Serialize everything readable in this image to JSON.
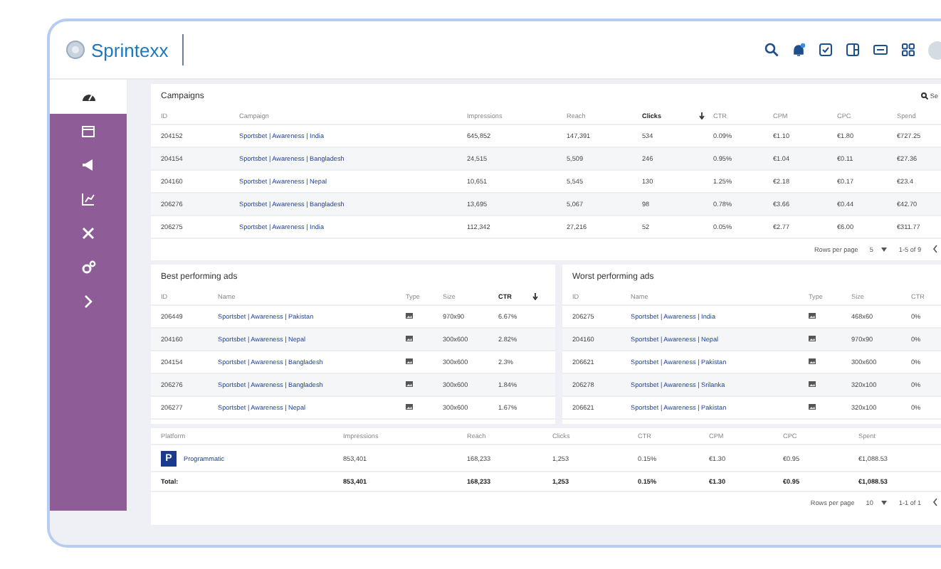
{
  "header": {
    "brand": "Sprintexx"
  },
  "sidebar": {
    "items": [
      {
        "selected": true
      },
      {
        "selected": false
      },
      {
        "selected": false
      },
      {
        "selected": false
      },
      {
        "selected": false
      },
      {
        "selected": false
      },
      {
        "selected": false
      }
    ]
  },
  "campaigns": {
    "title": "Campaigns",
    "search": "Se",
    "columns": [
      {
        "label": "ID",
        "kind": "text",
        "sorted": false
      },
      {
        "label": "Campaign",
        "kind": "link",
        "sorted": false
      },
      {
        "label": "Impressions",
        "kind": "text",
        "sorted": false
      },
      {
        "label": "Reach",
        "kind": "text",
        "sorted": false
      },
      {
        "label": "Clicks",
        "kind": "text",
        "sorted": true
      },
      {
        "label": "CTR",
        "kind": "text",
        "sorted": false
      },
      {
        "label": "CPM",
        "kind": "text",
        "sorted": false
      },
      {
        "label": "CPC",
        "kind": "text",
        "sorted": false
      },
      {
        "label": "Spend",
        "kind": "text",
        "sorted": false
      }
    ],
    "rows": [
      [
        "204152",
        "Sportsbet | Awareness | India",
        "645,852",
        "147,391",
        "534",
        "0.09%",
        "€1.10",
        "€1.80",
        "€727.25"
      ],
      [
        "204154",
        "Sportsbet | Awareness | Bangladesh",
        "24,515",
        "5,509",
        "246",
        "0.95%",
        "€1.04",
        "€0.11",
        "€27.36"
      ],
      [
        "204160",
        "Sportsbet | Awareness | Nepal",
        "10,651",
        "5,545",
        "130",
        "1.25%",
        "€2.18",
        "€0.17",
        "€23.4"
      ],
      [
        "206276",
        "Sportsbet | Awareness | Bangladesh",
        "13,695",
        "5,067",
        "98",
        "0.78%",
        "€3.66",
        "€0.44",
        "€42.70"
      ],
      [
        "206275",
        "Sportsbet | Awareness | India",
        "112,342",
        "27,216",
        "52",
        "0.05%",
        "€2.77",
        "€6.00",
        "€311.77"
      ]
    ],
    "pagination": {
      "label": "Rows per page",
      "per_page": "5",
      "range": "1-5 of 9"
    }
  },
  "ads": [
    {
      "title": "Best performing ads",
      "columns": [
        {
          "label": "ID",
          "sorted": false
        },
        {
          "label": "Name",
          "sorted": false
        },
        {
          "label": "Type",
          "sorted": false
        },
        {
          "label": "Size",
          "sorted": false
        },
        {
          "label": "CTR",
          "sorted": true
        }
      ],
      "rows": [
        {
          "id": "206449",
          "name": "Sportsbet | Awareness | Pakistan",
          "size": "970x90",
          "ctr": "6.67%"
        },
        {
          "id": "204160",
          "name": "Sportsbet | Awareness | Nepal",
          "size": "300x600",
          "ctr": "2.82%"
        },
        {
          "id": "204154",
          "name": "Sportsbet | Awareness | Bangladesh",
          "size": "300x600",
          "ctr": "2.3%"
        },
        {
          "id": "206276",
          "name": "Sportsbet | Awareness | Bangladesh",
          "size": "300x600",
          "ctr": "1.84%"
        },
        {
          "id": "206277",
          "name": "Sportsbet | Awareness | Nepal",
          "size": "300x600",
          "ctr": "1.67%"
        }
      ]
    },
    {
      "title": "Worst performing ads",
      "columns": [
        {
          "label": "ID",
          "sorted": false
        },
        {
          "label": "Name",
          "sorted": false
        },
        {
          "label": "Type",
          "sorted": false
        },
        {
          "label": "Size",
          "sorted": false
        },
        {
          "label": "CTR",
          "sorted": false
        }
      ],
      "rows": [
        {
          "id": "206275",
          "name": "Sportsbet | Awareness | India",
          "size": "468x60",
          "ctr": "0%"
        },
        {
          "id": "204160",
          "name": "Sportsbet | Awareness | Nepal",
          "size": "970x90",
          "ctr": "0%"
        },
        {
          "id": "206621",
          "name": "Sportsbet | Awareness | Pakistan",
          "size": "300x600",
          "ctr": "0%"
        },
        {
          "id": "206278",
          "name": "Sportsbet | Awareness | Srilanka",
          "size": "320x100",
          "ctr": "0%"
        },
        {
          "id": "206621",
          "name": "Sportsbet | Awareness | Pakistan",
          "size": "320x100",
          "ctr": "0%"
        }
      ]
    }
  ],
  "platforms": {
    "columns": [
      "Platform",
      "Impressions",
      "Reach",
      "Clicks",
      "CTR",
      "CPM",
      "CPC",
      "Spent"
    ],
    "rows": [
      {
        "badge": "P",
        "name": "Programmatic",
        "values": [
          "853,401",
          "168,233",
          "1,253",
          "0.15%",
          "€1.30",
          "€0.95",
          "€1,088.53"
        ]
      }
    ],
    "total": {
      "label": "Total:",
      "values": [
        "853,401",
        "168,233",
        "1,253",
        "0.15%",
        "€1.30",
        "€0.95",
        "€1,088.53"
      ]
    },
    "pagination": {
      "label": "Rows per page",
      "per_page": "10",
      "range": "1-1 of 1"
    }
  }
}
